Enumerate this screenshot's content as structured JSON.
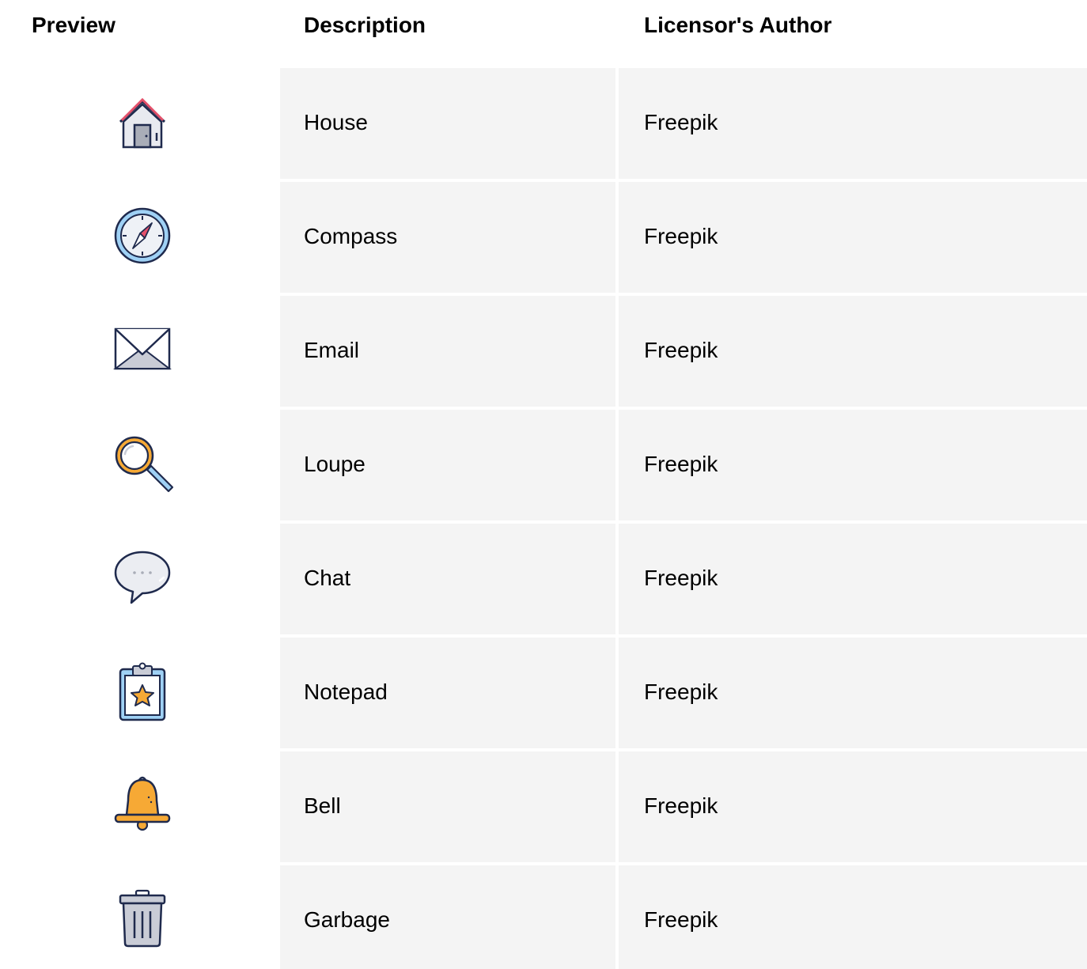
{
  "table": {
    "headers": {
      "preview": "Preview",
      "description": "Description",
      "author": "Licensor's Author"
    },
    "rows": [
      {
        "icon": "house-icon",
        "description": "House",
        "author": "Freepik"
      },
      {
        "icon": "compass-icon",
        "description": "Compass",
        "author": "Freepik"
      },
      {
        "icon": "email-icon",
        "description": "Email",
        "author": "Freepik"
      },
      {
        "icon": "loupe-icon",
        "description": "Loupe",
        "author": "Freepik"
      },
      {
        "icon": "chat-icon",
        "description": "Chat",
        "author": "Freepik"
      },
      {
        "icon": "notepad-icon",
        "description": "Notepad",
        "author": "Freepik"
      },
      {
        "icon": "bell-icon",
        "description": "Bell",
        "author": "Freepik"
      },
      {
        "icon": "garbage-icon",
        "description": "Garbage",
        "author": "Freepik"
      }
    ]
  },
  "colors": {
    "cell_background": "#f4f4f4",
    "outline": "#1f2a4d",
    "accent_red": "#e4506a",
    "accent_orange": "#f6a935",
    "accent_blue": "#9fd1f5",
    "neutral_gray": "#c9ccd6"
  }
}
